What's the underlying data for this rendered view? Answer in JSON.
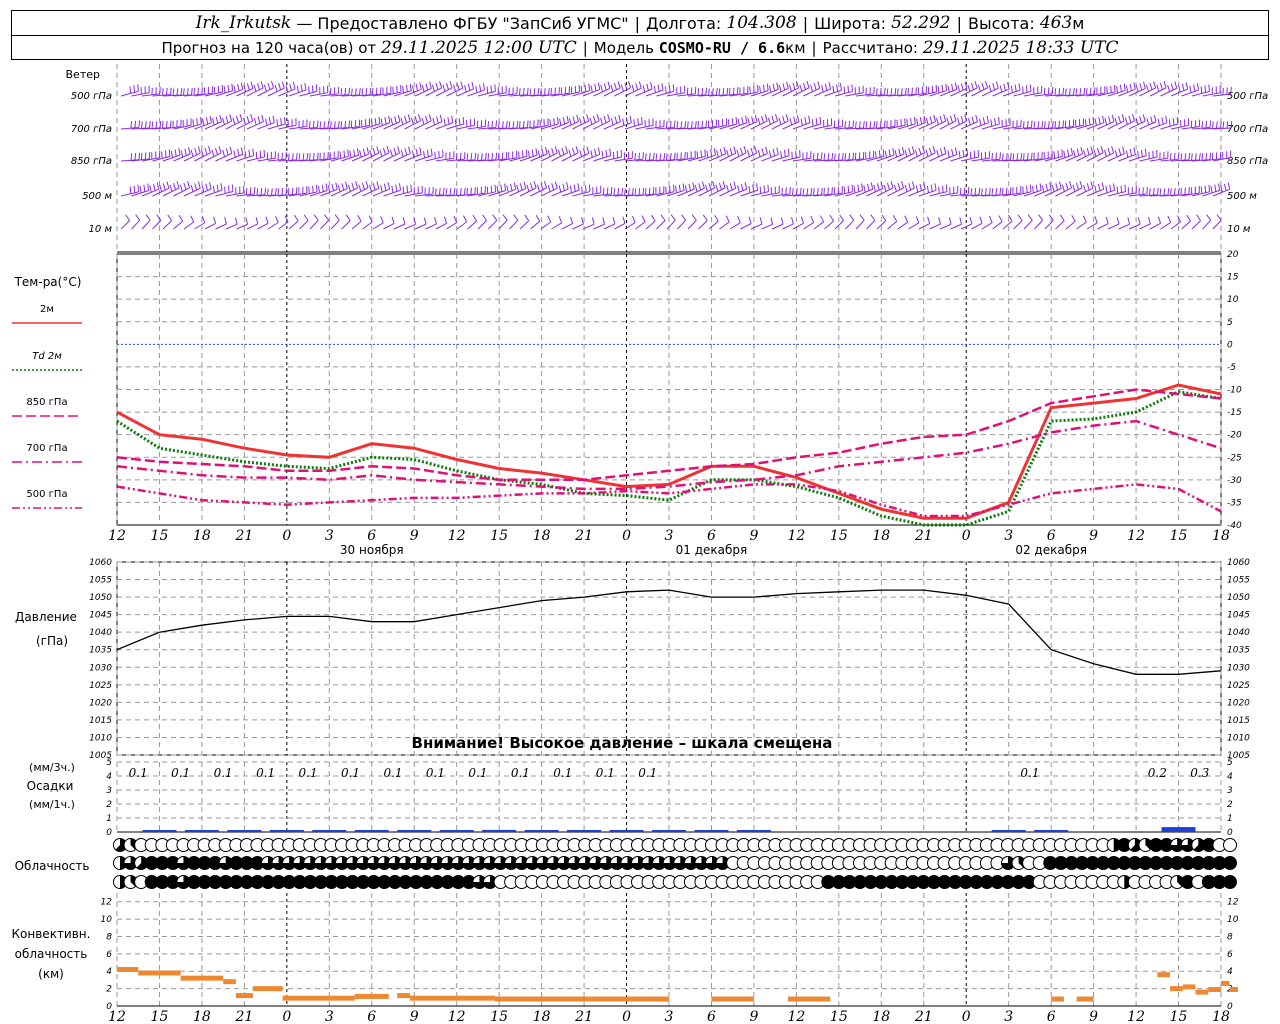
{
  "header": {
    "station": "Irk_Irkutsk",
    "provider": "— Предоставлено ФГБУ \"ЗапСиб УГМС\"",
    "longitude_label": "Долгота:",
    "longitude": "104.308",
    "latitude_label": "Широта:",
    "latitude": "52.292",
    "altitude_label": "Высота:",
    "altitude": "463",
    "altitude_unit": "м",
    "forecast_prefix": "Прогноз на 120 часа(ов) от",
    "forecast_start": "29.11.2025 12:00 UTC",
    "model_label": "Модель",
    "model_name": "COSMO-RU / 6.6",
    "model_unit": "км",
    "calc_label": "Рассчитано:",
    "calc_time": "29.11.2025 18:33 UTC"
  },
  "time_axis": {
    "hours": [
      "12",
      "15",
      "18",
      "21",
      "0",
      "3",
      "6",
      "9",
      "12",
      "15",
      "18",
      "21",
      "0",
      "3",
      "6",
      "9",
      "12",
      "15",
      "18",
      "21",
      "0",
      "3",
      "6",
      "9",
      "12",
      "15",
      "18"
    ],
    "day_labels": [
      {
        "after_index": 4,
        "text": "30 ноября"
      },
      {
        "after_index": 12,
        "text": "01 декабря"
      },
      {
        "after_index": 20,
        "text": "02 декабря"
      }
    ]
  },
  "wind_panel": {
    "title": "Ветер",
    "levels": [
      "500 гПа",
      "700 гПа",
      "850 гПа",
      "500 м",
      "10 м"
    ]
  },
  "temp_panel": {
    "title": "Тем-ра(°С)",
    "yticks": [
      "20",
      "15",
      "10",
      "5",
      "0",
      "-5",
      "-10",
      "-15",
      "-20",
      "-25",
      "-30",
      "-35",
      "-40"
    ]
  },
  "pressure_panel": {
    "title": "Давление",
    "unit": "(гПа)",
    "yticks": [
      "1060",
      "1055",
      "1050",
      "1045",
      "1040",
      "1035",
      "1030",
      "1025",
      "1020",
      "1015",
      "1010",
      "1005"
    ],
    "warning": "Внимание! Высокое давление – шкала смещена"
  },
  "precip_panel": {
    "label_top": "(мм/3ч.)",
    "title": "Осадки",
    "label_bottom": "(мм/1ч.)",
    "yticks": [
      "5",
      "4",
      "3",
      "2",
      "1",
      "0"
    ],
    "amounts": [
      {
        "index": 1,
        "text": "0.1"
      },
      {
        "index": 2,
        "text": "0.1"
      },
      {
        "index": 3,
        "text": "0.1"
      },
      {
        "index": 4,
        "text": "0.1"
      },
      {
        "index": 5,
        "text": "0.1"
      },
      {
        "index": 6,
        "text": "0.1"
      },
      {
        "index": 7,
        "text": "0.1"
      },
      {
        "index": 8,
        "text": "0.1"
      },
      {
        "index": 9,
        "text": "0.1"
      },
      {
        "index": 10,
        "text": "0.1"
      },
      {
        "index": 11,
        "text": "0.1"
      },
      {
        "index": 12,
        "text": "0.1"
      },
      {
        "index": 13,
        "text": "0.1"
      },
      {
        "index": 22,
        "text": "0.1"
      },
      {
        "index": 25,
        "text": "0.2"
      },
      {
        "index": 26,
        "text": "0.3"
      }
    ]
  },
  "cloud_panel": {
    "title": "Облачность"
  },
  "conv_panel": {
    "title_line1": "Конвективн.",
    "title_line2": "облачность",
    "unit": "(км)",
    "yticks": [
      "12",
      "10",
      "8",
      "6",
      "4",
      "2",
      "0"
    ]
  },
  "colors": {
    "t2m": "#ee3333",
    "td2m": "#0a7a0a",
    "t850": "#dd1177",
    "t700": "#dd1177",
    "t500": "#dd1177",
    "wind": "#8a2be2",
    "precip": "#1e3fd8",
    "conv": "#ee8833",
    "zero_line": "#2244ff"
  },
  "chart_data": [
    {
      "type": "line",
      "title": "Тем-ра(°С)",
      "x": [
        "12",
        "15",
        "18",
        "21",
        "0",
        "3",
        "6",
        "9",
        "12",
        "15",
        "18",
        "21",
        "0",
        "3",
        "6",
        "9",
        "12",
        "15",
        "18",
        "21",
        "0",
        "3",
        "6",
        "9",
        "12",
        "15",
        "18"
      ],
      "ylim": [
        -40,
        20
      ],
      "series": [
        {
          "name": "2м",
          "style": "solid",
          "values": [
            -15,
            -20,
            -21,
            -23,
            -24.5,
            -25,
            -22,
            -23,
            -25.5,
            -27.5,
            -28.5,
            -30,
            -31.5,
            -31,
            -27,
            -27,
            -29.5,
            -33,
            -36.5,
            -38.5,
            -38.5,
            -35,
            -14,
            -13,
            -12,
            -9,
            -11
          ]
        },
        {
          "name": "Td 2м",
          "style": "dotted",
          "values": [
            -17,
            -23,
            -24.5,
            -26,
            -27,
            -27.5,
            -25,
            -25.5,
            -28,
            -30,
            -31,
            -33,
            -33.5,
            -34.5,
            -30,
            -30,
            -31.5,
            -34,
            -38,
            -40.5,
            -41,
            -37,
            -17,
            -16.5,
            -15,
            -10.5,
            -12
          ]
        },
        {
          "name": "850 гПа",
          "style": "dash",
          "values": [
            -25,
            -26,
            -26.5,
            -27,
            -28,
            -28,
            -27,
            -27.5,
            -29,
            -30,
            -30,
            -30,
            -29,
            -28,
            -27,
            -26.5,
            -25,
            -24,
            -22,
            -20.5,
            -20,
            -17,
            -13,
            -11.5,
            -10,
            -11,
            -12
          ]
        },
        {
          "name": "700 гПа",
          "style": "dashdot",
          "values": [
            -27,
            -28,
            -29,
            -29.5,
            -29.5,
            -30,
            -29,
            -30,
            -30.5,
            -31,
            -31.5,
            -32,
            -32,
            -31.5,
            -30.5,
            -30,
            -29,
            -27,
            -26,
            -25,
            -24,
            -22,
            -19.5,
            -18,
            -17,
            -20,
            -23
          ]
        },
        {
          "name": "500 гПа",
          "style": "dashdotdot",
          "values": [
            -31.5,
            -33,
            -34.5,
            -35,
            -35.5,
            -35,
            -34.5,
            -34,
            -34,
            -33.5,
            -33,
            -33,
            -32.5,
            -33,
            -32,
            -31,
            -31,
            -32.5,
            -35.5,
            -38,
            -38,
            -35.5,
            -33,
            -32,
            -31,
            -32,
            -37
          ]
        }
      ]
    },
    {
      "type": "line",
      "title": "Давление",
      "x": [
        "12",
        "15",
        "18",
        "21",
        "0",
        "3",
        "6",
        "9",
        "12",
        "15",
        "18",
        "21",
        "0",
        "3",
        "6",
        "9",
        "12",
        "15",
        "18",
        "21",
        "0",
        "3",
        "6",
        "9",
        "12",
        "15",
        "18"
      ],
      "ylim": [
        1005,
        1060
      ],
      "series": [
        {
          "name": "Давление",
          "values": [
            1035,
            1040,
            1042,
            1043.5,
            1044.5,
            1044.5,
            1043,
            1043,
            1045,
            1047,
            1049,
            1050,
            1051.5,
            1052,
            1050,
            1050,
            1051,
            1051.5,
            1052,
            1052,
            1050.5,
            1048,
            1035,
            1031,
            1028,
            1028,
            1029
          ]
        }
      ]
    },
    {
      "type": "bar",
      "title": "Осадки",
      "x": [
        "12",
        "15",
        "18",
        "21",
        "0",
        "3",
        "6",
        "9",
        "12",
        "15",
        "18",
        "21",
        "0",
        "3",
        "6",
        "9",
        "12",
        "15",
        "18",
        "21",
        "0",
        "3",
        "6",
        "9",
        "12",
        "15",
        "18"
      ],
      "ylim": [
        0,
        5
      ],
      "values_mm_1h": [
        0,
        0.05,
        0.05,
        0.05,
        0.05,
        0.05,
        0.03,
        0.05,
        0.1,
        0.15,
        0.05,
        0.1,
        0.05,
        0.05,
        0.03,
        0.03,
        0,
        0,
        0,
        0,
        0,
        0.05,
        0.05,
        0,
        0,
        0.35,
        0
      ]
    },
    {
      "type": "bar",
      "title": "Конвективн. облачность",
      "x": [
        "12",
        "15",
        "18",
        "21",
        "0",
        "3",
        "6",
        "9",
        "12",
        "15",
        "18",
        "21",
        "0",
        "3",
        "6",
        "9",
        "12",
        "15",
        "18",
        "21",
        "0",
        "3",
        "6",
        "9",
        "12",
        "15",
        "18"
      ],
      "ylim": [
        0,
        13
      ],
      "segments_km": [
        {
          "from": 0,
          "to": 0.5,
          "value": 4.2
        },
        {
          "from": 0.5,
          "to": 1.5,
          "value": 3.8
        },
        {
          "from": 1.5,
          "to": 2.5,
          "value": 3.2
        },
        {
          "from": 2.5,
          "to": 2.8,
          "value": 2.8
        },
        {
          "from": 2.8,
          "to": 3.2,
          "value": 1.2
        },
        {
          "from": 3.2,
          "to": 3.9,
          "value": 2.0
        },
        {
          "from": 3.9,
          "to": 5.6,
          "value": 0.9
        },
        {
          "from": 5.6,
          "to": 6.4,
          "value": 1.1
        },
        {
          "from": 6.6,
          "to": 6.9,
          "value": 1.2
        },
        {
          "from": 6.9,
          "to": 8.9,
          "value": 0.9
        },
        {
          "from": 8.9,
          "to": 13.0,
          "value": 0.8
        },
        {
          "from": 14.0,
          "to": 15.0,
          "value": 0.8
        },
        {
          "from": 15.8,
          "to": 16.8,
          "value": 0.8
        },
        {
          "from": 22.0,
          "to": 22.3,
          "value": 0.8
        },
        {
          "from": 22.6,
          "to": 23.0,
          "value": 0.8
        },
        {
          "from": 24.5,
          "to": 24.8,
          "value": 3.6
        },
        {
          "from": 24.8,
          "to": 25.1,
          "value": 2.0
        },
        {
          "from": 25.1,
          "to": 25.4,
          "value": 2.2
        },
        {
          "from": 25.4,
          "to": 25.7,
          "value": 1.6
        },
        {
          "from": 25.7,
          "to": 26.0,
          "value": 1.9
        },
        {
          "from": 26.0,
          "to": 26.2,
          "value": 2.6
        },
        {
          "from": 26.2,
          "to": 26.4,
          "value": 1.9
        }
      ]
    },
    {
      "type": "table",
      "title": "Облачность",
      "rows": 3,
      "cover_eighths_per_column": [
        [
          5,
          3,
          0,
          0,
          0,
          0,
          0,
          0,
          0,
          0,
          0,
          0,
          0,
          0,
          0,
          0,
          0,
          0,
          0,
          0,
          0,
          0,
          0,
          0,
          0,
          0,
          0,
          0,
          0,
          0,
          0,
          0,
          0,
          0,
          0,
          0,
          0,
          0,
          0,
          0,
          0,
          0,
          0,
          0,
          0,
          0,
          0,
          0,
          0,
          0,
          0,
          0,
          0,
          0,
          0,
          0,
          0,
          0,
          0,
          0,
          0,
          0,
          0,
          0,
          0,
          0,
          0,
          0,
          0,
          0,
          0,
          0,
          0,
          0,
          0,
          0,
          0,
          0,
          0,
          0,
          0,
          0,
          0,
          0,
          0,
          0,
          0,
          0,
          0,
          0,
          0,
          0,
          0,
          0,
          4,
          8,
          5,
          3,
          8,
          8,
          6,
          6,
          5,
          8,
          0,
          0
        ],
        [
          4,
          6,
          5,
          8,
          8,
          8,
          6,
          8,
          8,
          8,
          6,
          8,
          8,
          8,
          6,
          6,
          6,
          6,
          6,
          6,
          6,
          6,
          6,
          6,
          6,
          6,
          6,
          6,
          6,
          6,
          6,
          6,
          6,
          6,
          6,
          6,
          6,
          6,
          6,
          6,
          6,
          6,
          6,
          6,
          6,
          6,
          6,
          6,
          6,
          6,
          6,
          6,
          6,
          6,
          6,
          6,
          6,
          6,
          0,
          0,
          0,
          0,
          0,
          0,
          0,
          0,
          0,
          0,
          0,
          0,
          0,
          0,
          0,
          0,
          0,
          0,
          0,
          0,
          0,
          0,
          0,
          0,
          0,
          0,
          6,
          3,
          0,
          0,
          8,
          8,
          8,
          8,
          8,
          8,
          8,
          8,
          8,
          8,
          8,
          8,
          8,
          8,
          8,
          8,
          8,
          8
        ],
        [
          4,
          3,
          0,
          8,
          8,
          8,
          6,
          8,
          8,
          8,
          8,
          8,
          8,
          8,
          8,
          8,
          8,
          8,
          8,
          8,
          8,
          8,
          8,
          8,
          8,
          8,
          8,
          8,
          8,
          8,
          8,
          8,
          8,
          8,
          6,
          6,
          0,
          0,
          0,
          0,
          0,
          0,
          0,
          0,
          0,
          0,
          0,
          0,
          0,
          0,
          0,
          0,
          0,
          0,
          0,
          0,
          0,
          0,
          0,
          0,
          0,
          0,
          0,
          0,
          0,
          0,
          0,
          8,
          8,
          8,
          8,
          8,
          8,
          8,
          8,
          8,
          8,
          8,
          8,
          8,
          8,
          8,
          8,
          8,
          8,
          8,
          8,
          0,
          0,
          0,
          0,
          0,
          0,
          0,
          0,
          4,
          0,
          0,
          0,
          0,
          3,
          8,
          0,
          8,
          8,
          8
        ]
      ]
    }
  ]
}
